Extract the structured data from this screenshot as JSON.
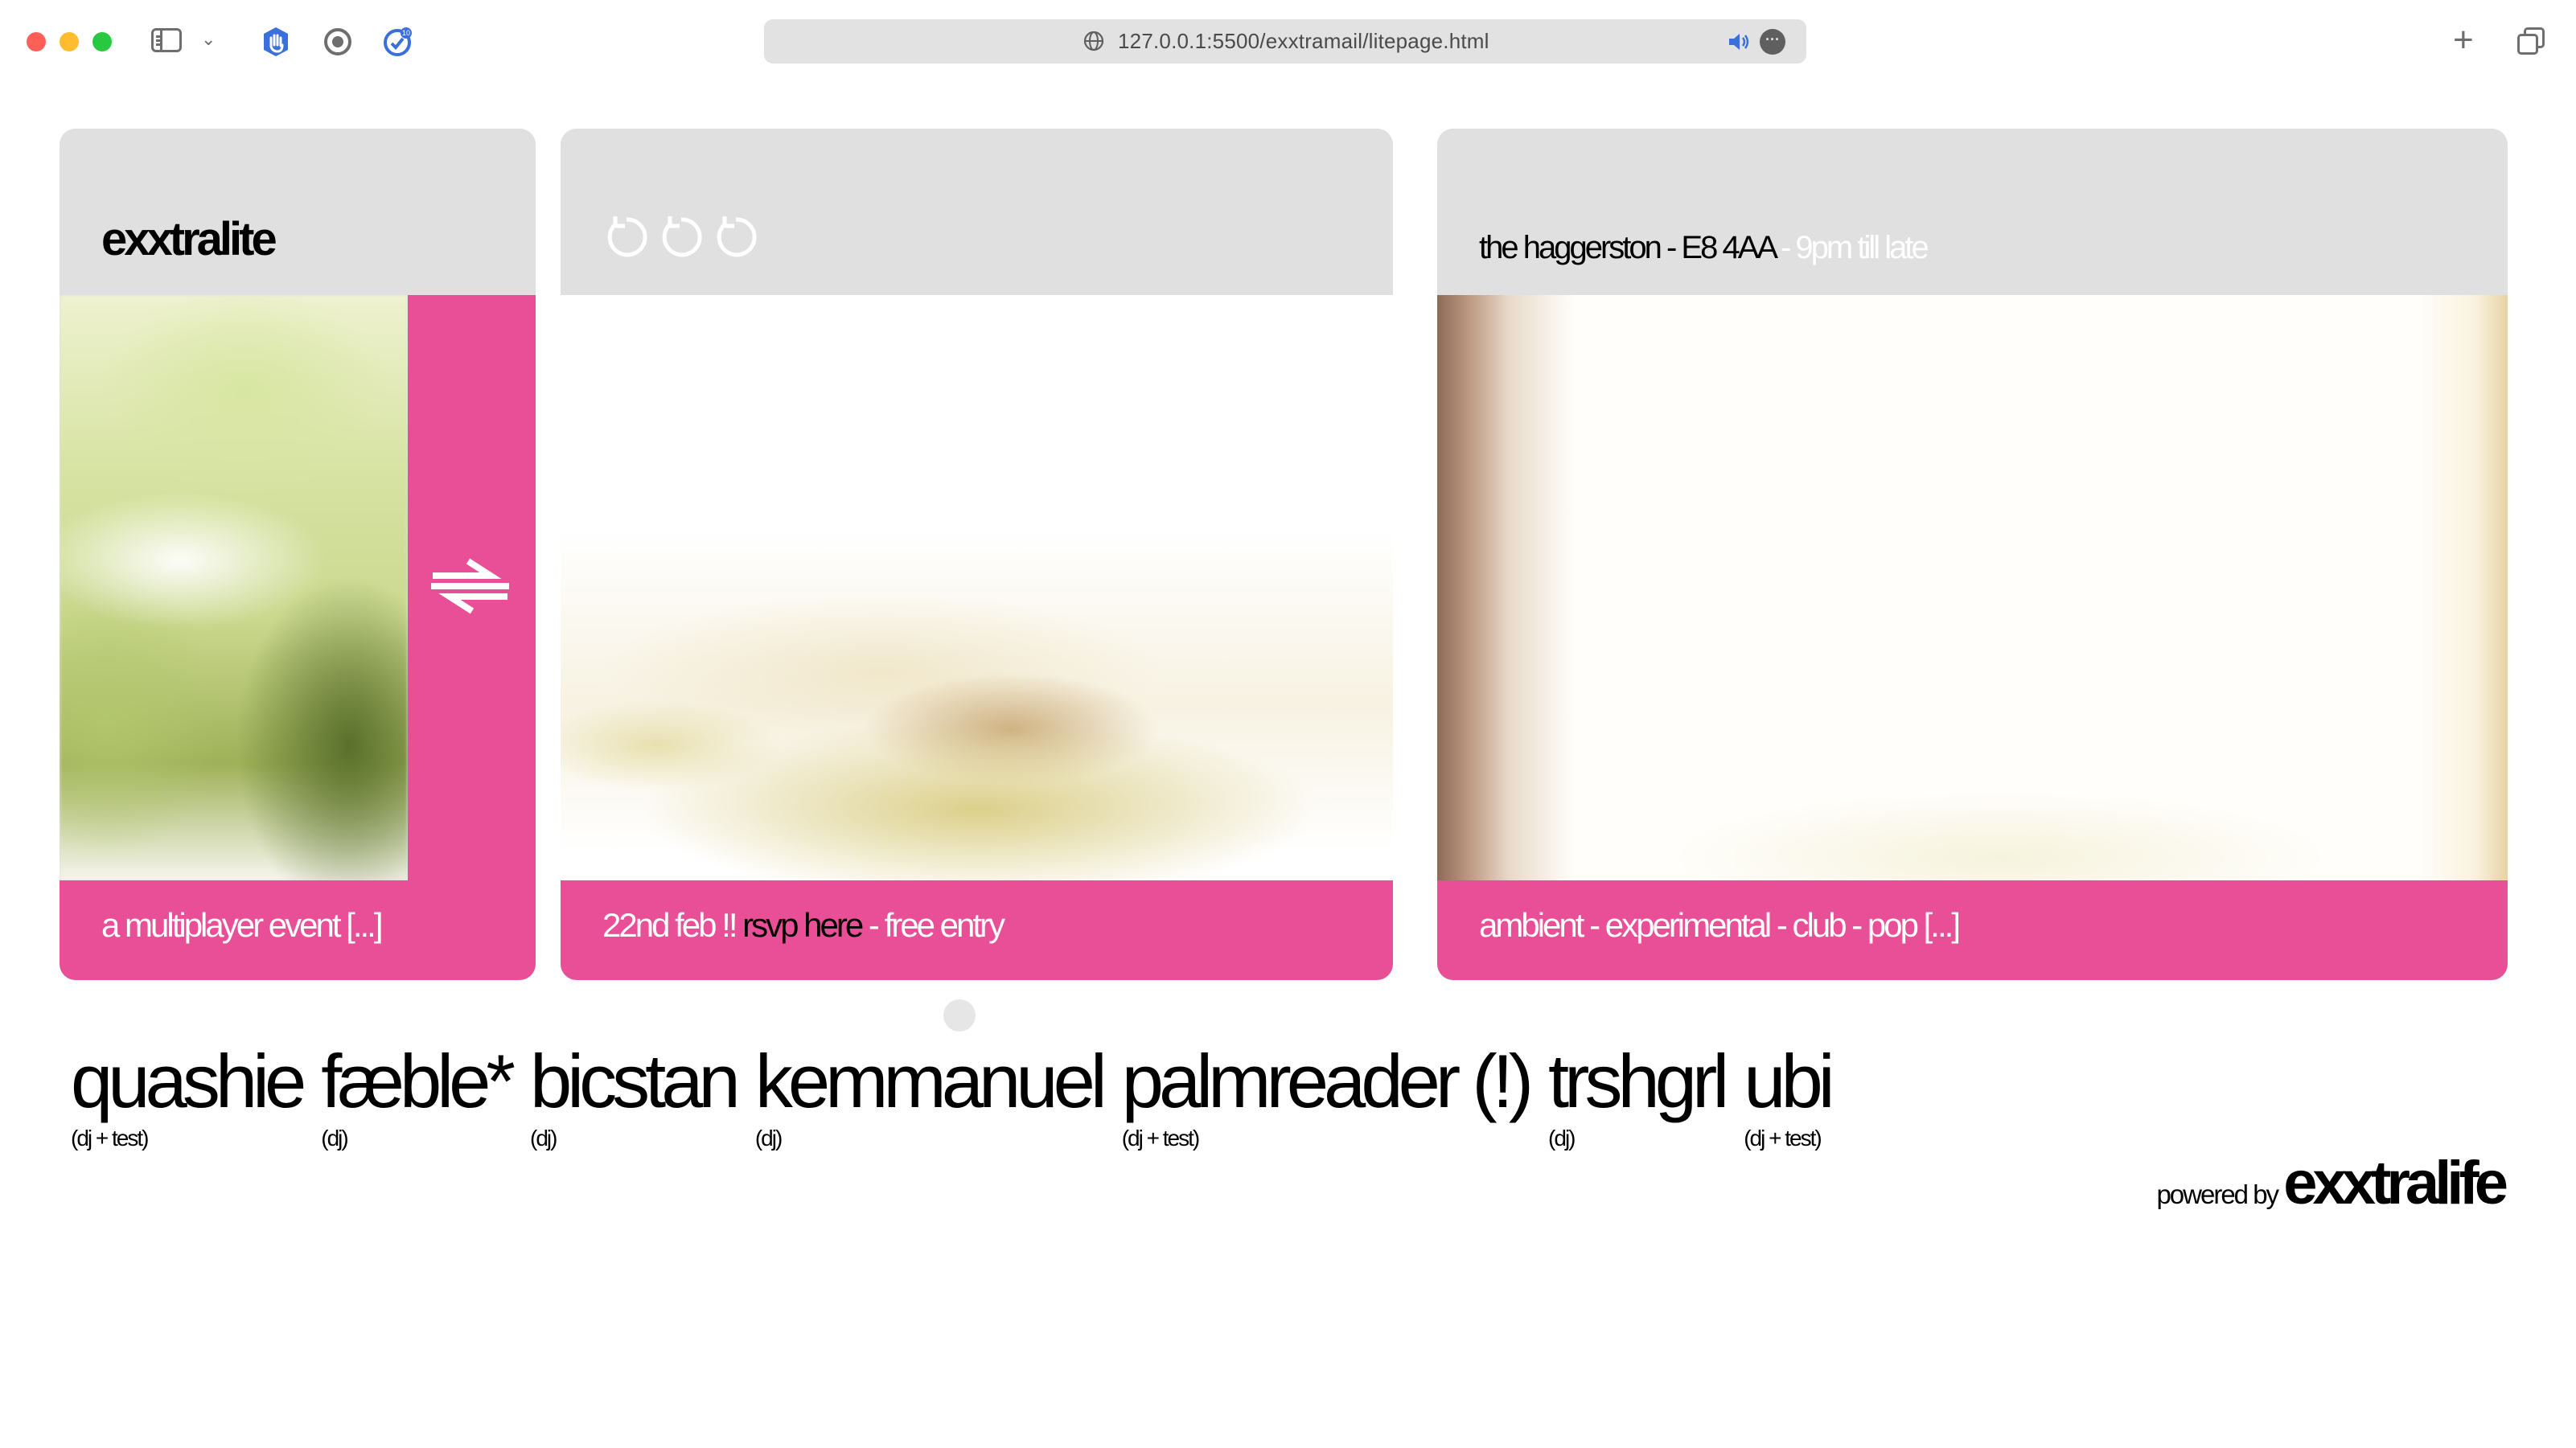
{
  "browser": {
    "url": "127.0.0.1:5500/exxtramail/litepage.html"
  },
  "cards": {
    "intro": {
      "title": "exxtralite",
      "footer": "a multiplayer event [...]"
    },
    "date": {
      "footer_date": "22nd feb !! ",
      "footer_rsvp": "rsvp here",
      "footer_rest": " - free entry"
    },
    "venue": {
      "place": "the haggerston - E8 4AA",
      "time": " - 9pm till late",
      "footer": "ambient - experimental - club - pop [...]"
    }
  },
  "lineup": [
    {
      "name": "quashie",
      "role": "(dj + test)"
    },
    {
      "name": "fæble*",
      "role": "(dj)"
    },
    {
      "name": "bicstan",
      "role": "(dj)"
    },
    {
      "name": "kemmanuel",
      "role": "(dj)"
    },
    {
      "name": "palmreader (!)",
      "role": "(dj + test)"
    },
    {
      "name": "trshgrl",
      "role": "(dj)"
    },
    {
      "name": "ubi",
      "role": "(dj + test)"
    }
  ],
  "footer": {
    "powered_by": "powered by ",
    "brand": "exxtralife"
  },
  "colors": {
    "accent_pink": "#e94f96",
    "panel_grey": "#e0e0e0"
  }
}
